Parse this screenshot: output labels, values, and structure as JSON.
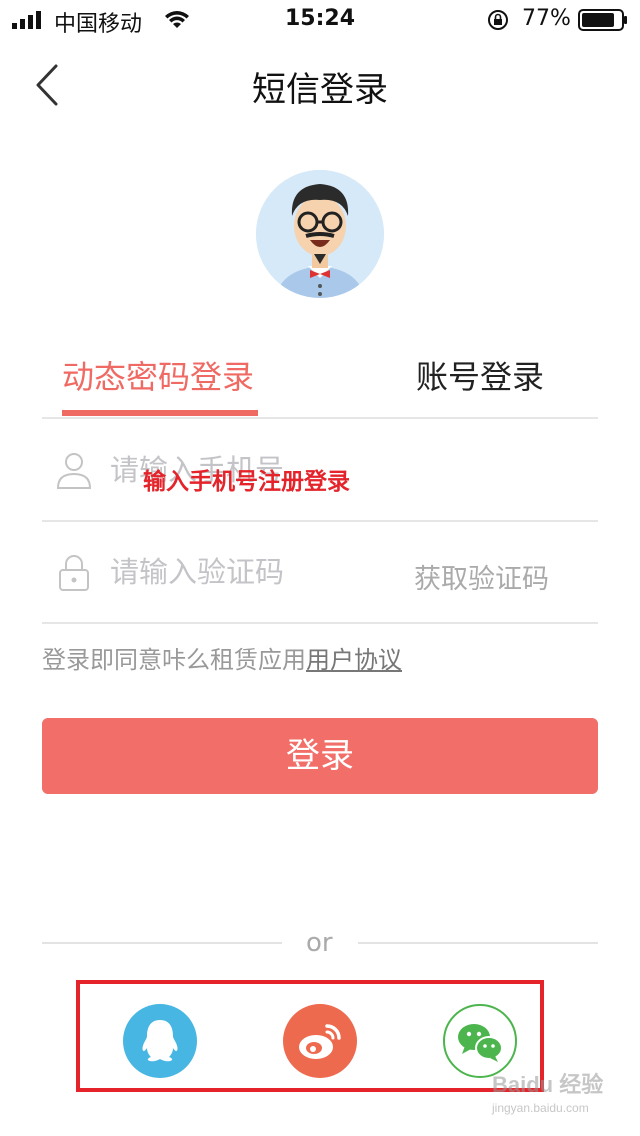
{
  "status_bar": {
    "carrier": "中国移动",
    "time": "15:24",
    "battery_percent": "77%"
  },
  "nav": {
    "title": "短信登录"
  },
  "tabs": [
    {
      "label": "动态密码登录",
      "active": true
    },
    {
      "label": "账号登录",
      "active": false
    }
  ],
  "phone_field": {
    "placeholder": "请输入手机号"
  },
  "annotation": "输入手机号注册登录",
  "code_field": {
    "placeholder": "请输入验证码",
    "get_code_label": "获取验证码"
  },
  "agreement": {
    "text": "登录即同意咔么租赁应用",
    "link": "用户协议"
  },
  "login_button": "登录",
  "or_label": "or",
  "social": [
    {
      "name": "qq-icon"
    },
    {
      "name": "weibo-icon"
    },
    {
      "name": "wechat-icon"
    }
  ],
  "watermark": {
    "text": "Baidu 经验",
    "url_text": "jingyan.baidu.com"
  },
  "colors": {
    "accent": "#f06a64",
    "login_button": "#f26e69",
    "qq": "#47b6e2",
    "weibo": "#ee6a4f",
    "wechat": "#4cb54d",
    "annotation": "#e4242a"
  }
}
